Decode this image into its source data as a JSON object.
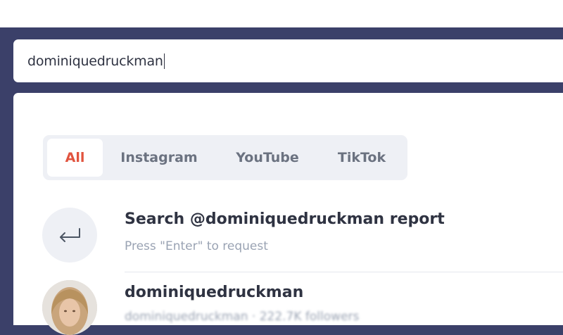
{
  "search": {
    "value": "dominiquedruckman"
  },
  "tabs": [
    {
      "label": "All",
      "active": true
    },
    {
      "label": "Instagram",
      "active": false
    },
    {
      "label": "YouTube",
      "active": false
    },
    {
      "label": "TikTok",
      "active": false
    }
  ],
  "search_result": {
    "prefix": "Search ",
    "handle": "@dominiquedruckman",
    "suffix": " report",
    "hint": "Press \"Enter\" to request",
    "icon": "enter-return-icon"
  },
  "profile_result": {
    "name": "dominiquedruckman",
    "meta": "dominiquedruckman · 222.7K followers"
  },
  "colors": {
    "background": "#3b4069",
    "accent": "#e1533e",
    "text": "#2f3342",
    "muted": "#9aa3b3",
    "tab_bg": "#eef0f5"
  }
}
